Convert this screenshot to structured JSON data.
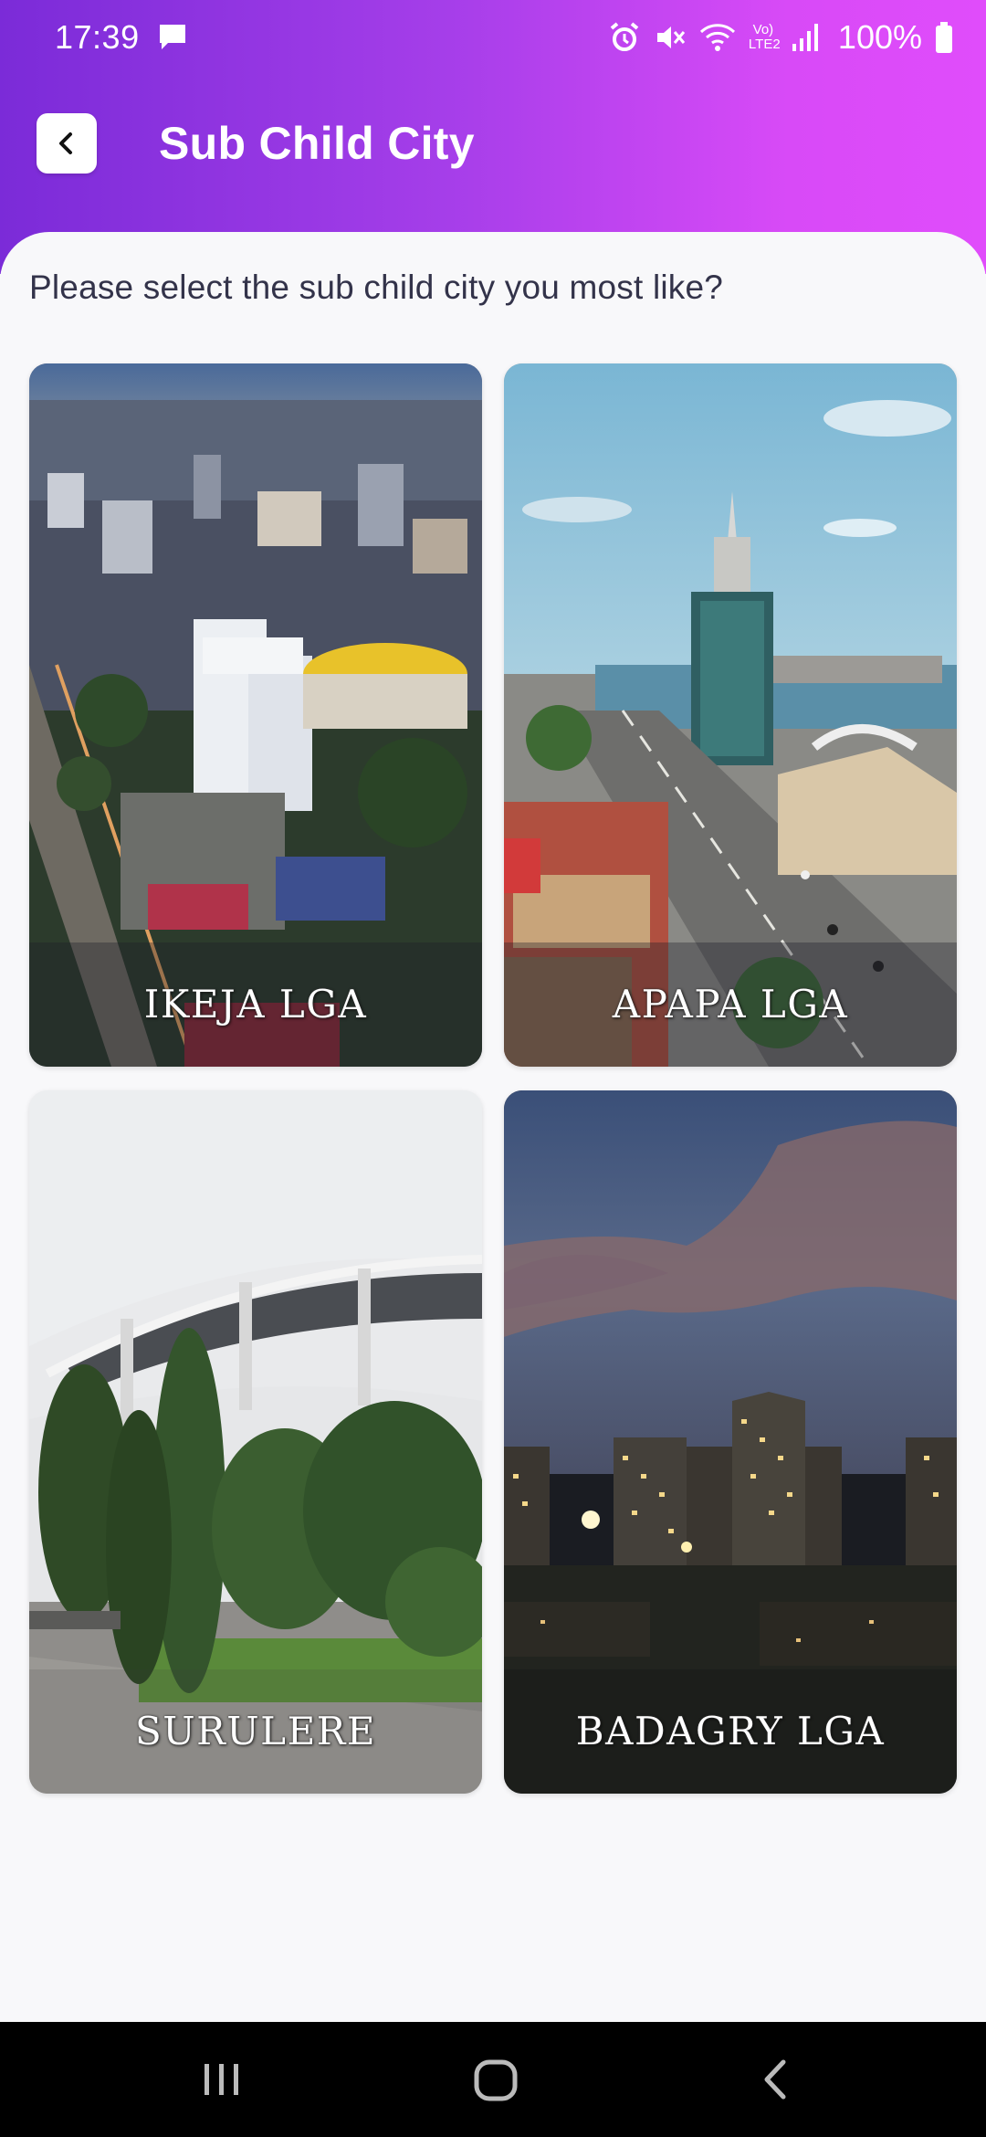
{
  "status_bar": {
    "time": "17:39",
    "battery": "100%",
    "network_label": "Vo) LTE2",
    "icons": [
      "message-icon",
      "alarm-icon",
      "mute-icon",
      "wifi-icon",
      "signal-icon",
      "battery-icon"
    ]
  },
  "app_bar": {
    "title": "Sub Child City",
    "back_icon": "chevron-left-icon"
  },
  "prompt": "Please select the sub child city you most like?",
  "cities": [
    {
      "label": "IKEJA LGA"
    },
    {
      "label": "APAPA LGA"
    },
    {
      "label": "SURULERE"
    },
    {
      "label": "BADAGRY LGA"
    }
  ],
  "nav_bar": {
    "icons": [
      "recents-icon",
      "home-icon",
      "back-icon"
    ]
  },
  "colors": {
    "header_gradient_start": "#7b2bd8",
    "header_gradient_end": "#e04cfb",
    "background": "#f8f8fa",
    "prompt_text": "#33334a"
  }
}
